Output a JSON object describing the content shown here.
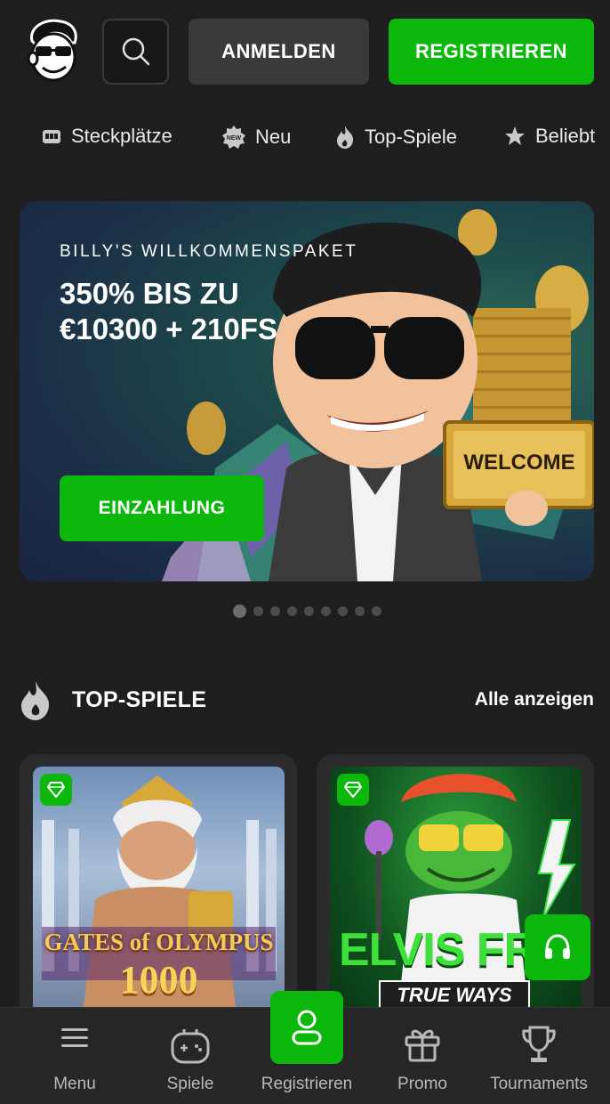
{
  "header": {
    "login_label": "ANMELDEN",
    "register_label": "REGISTRIEREN",
    "search_icon": "search-icon",
    "logo": "billy-mascot-logo"
  },
  "categories": [
    {
      "label": "Steckplätze",
      "icon": "slot-machine-icon"
    },
    {
      "label": "Neu",
      "icon": "new-badge-icon"
    },
    {
      "label": "Top-Spiele",
      "icon": "flame-icon"
    },
    {
      "label": "Beliebt",
      "icon": "star-icon"
    }
  ],
  "banner": {
    "subtitle": "BILLY'S WILLKOMMENSPAKET",
    "title": "350% BIS ZU €10300 + 210FS",
    "cta_label": "EINZAHLUNG",
    "sign_text": "WELCOME",
    "slide_count": 9,
    "active_slide": 1
  },
  "top_games": {
    "title": "TOP-SPIELE",
    "see_all_label": "Alle anzeigen",
    "games": [
      {
        "name": "Gates of Olympus 1000",
        "line1": "GATES of OLYMPUS",
        "line2": "1000"
      },
      {
        "name": "Elvis Frog TRUE WAYS",
        "line1": "ELVIS FRO",
        "line2": "TRUE WAYS"
      }
    ]
  },
  "bottom_nav": [
    {
      "label": "Menu",
      "icon": "menu-icon"
    },
    {
      "label": "Spiele",
      "icon": "gamepad-icon"
    },
    {
      "label": "Registrieren",
      "icon": "user-icon"
    },
    {
      "label": "Promo",
      "icon": "gift-icon"
    },
    {
      "label": "Tournaments",
      "icon": "trophy-icon"
    }
  ],
  "colors": {
    "accent_green": "#0cb80c",
    "background": "#1e1e1f",
    "button_gray": "#3a3a3c"
  }
}
